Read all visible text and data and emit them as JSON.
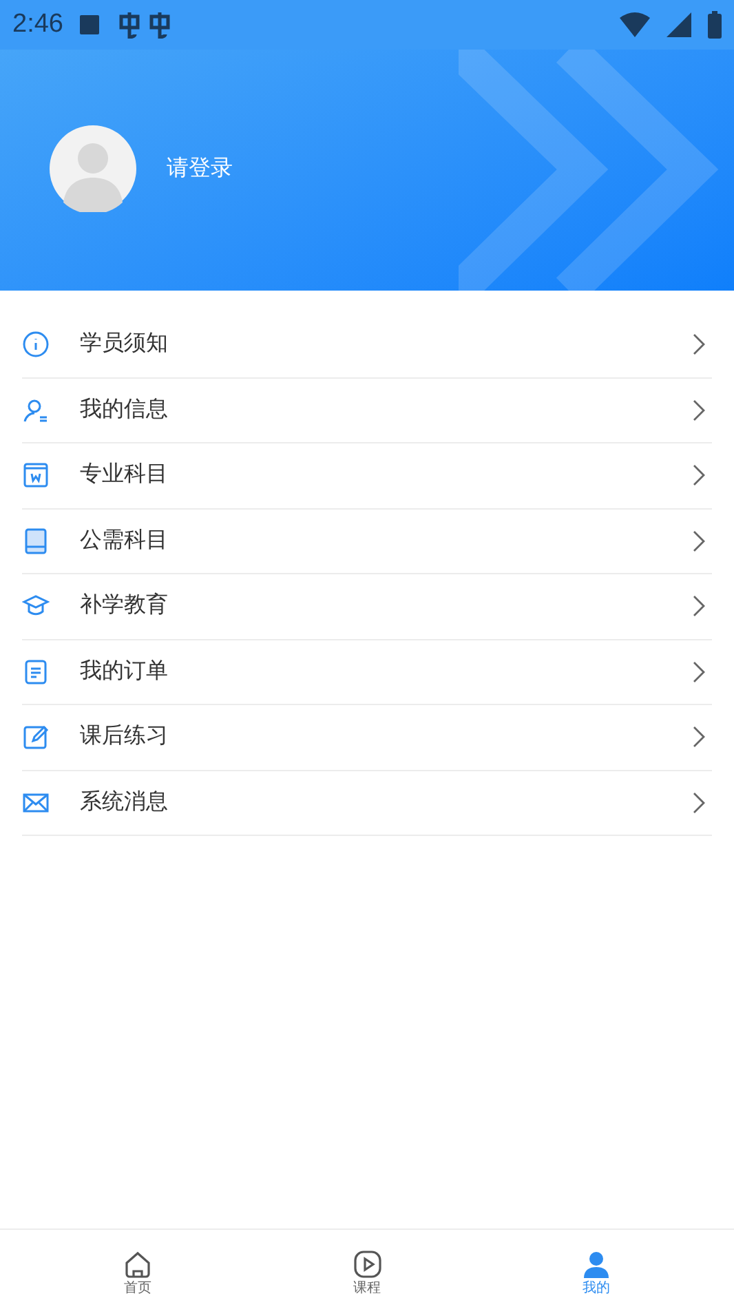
{
  "status_bar": {
    "time": "2:46"
  },
  "profile": {
    "login_label": "请登录"
  },
  "menu": [
    {
      "kind": "info",
      "label": "学员须知"
    },
    {
      "kind": "user",
      "label": "我的信息"
    },
    {
      "kind": "major",
      "label": "专业科目"
    },
    {
      "kind": "book",
      "label": "公需科目"
    },
    {
      "kind": "cap",
      "label": "补学教育"
    },
    {
      "kind": "order",
      "label": "我的订单"
    },
    {
      "kind": "edit",
      "label": "课后练习"
    },
    {
      "kind": "mail",
      "label": "系统消息"
    }
  ],
  "tabs": [
    {
      "kind": "home",
      "label": "首页",
      "selected": false
    },
    {
      "kind": "play",
      "label": "课程",
      "selected": false
    },
    {
      "kind": "me",
      "label": "我的",
      "selected": true
    }
  ]
}
